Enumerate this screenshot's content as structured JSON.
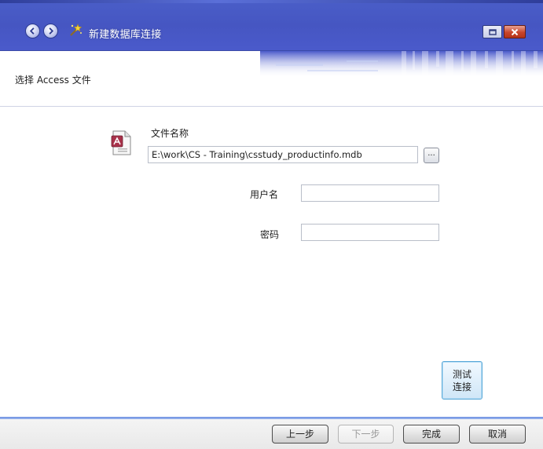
{
  "window": {
    "title": "新建数据库连接",
    "icons": {
      "back": "back-arrow-icon",
      "forward": "forward-arrow-icon",
      "app": "wizard-wand-icon",
      "restore": "restore-window-icon",
      "close": "close-icon"
    }
  },
  "header": {
    "title": "选择 Access 文件"
  },
  "form": {
    "file_label": "文件名称",
    "file_value": "E:\\work\\CS - Training\\csstudy_productinfo.mdb",
    "browse_label": "...",
    "user_label": "用户名",
    "user_value": "",
    "password_label": "密码",
    "password_value": "",
    "file_icon": "access-file-icon"
  },
  "test_button": {
    "line1": "测试",
    "line2": "连接"
  },
  "footer": {
    "prev_label": "上一步",
    "next_label": "下一步",
    "finish_label": "完成",
    "cancel_label": "取消"
  },
  "colors": {
    "titlebar": "#4656c2",
    "header_title": "#4b46b8",
    "footer_line": "#6a8ee0"
  }
}
